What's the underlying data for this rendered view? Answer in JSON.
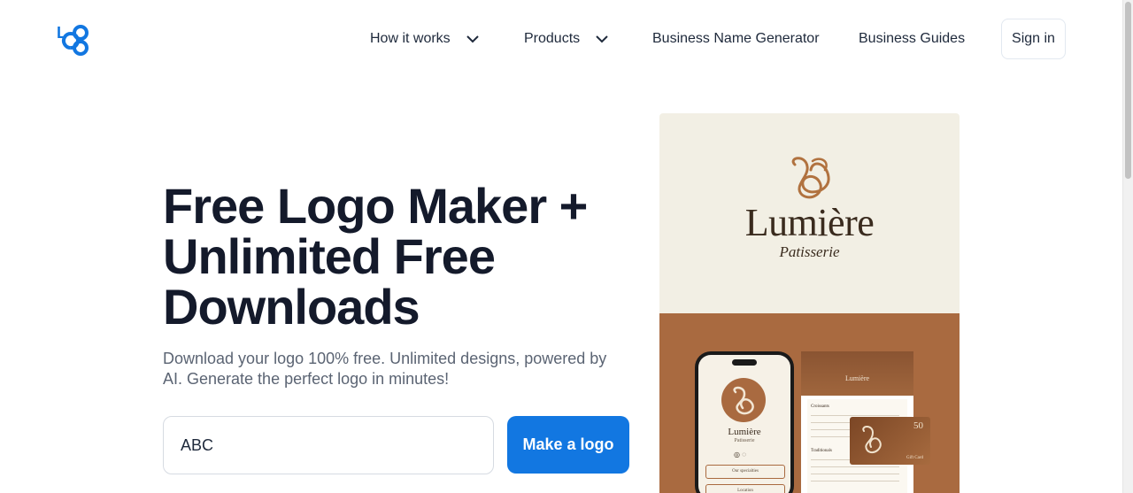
{
  "header": {
    "logo_text": "LOGO",
    "nav": [
      {
        "label": "How it works",
        "has_dropdown": true
      },
      {
        "label": "Products",
        "has_dropdown": true
      },
      {
        "label": "Business Name Generator",
        "has_dropdown": false
      },
      {
        "label": "Business Guides",
        "has_dropdown": false
      }
    ],
    "signin_label": "Sign in"
  },
  "hero": {
    "title": "Free Logo Maker + Unlimited Free Downloads",
    "subtitle": "Download your logo 100% free. Unlimited designs, powered by AI. Generate the perfect logo in minutes!",
    "input_value": "ABC",
    "cta_label": "Make a logo"
  },
  "showcase": {
    "brand_name": "Lumière",
    "brand_sub": "Patisserie",
    "phone_name": "Lumière",
    "phone_sub": "Patisserie",
    "phone_buttons": [
      "Our specialties",
      "Location"
    ],
    "menu_title": "Lumière",
    "menu_sections": [
      "Croissants",
      "Traditionals"
    ],
    "gift_value": "50",
    "gift_label": "Gift Card"
  },
  "colors": {
    "accent": "#1277e1",
    "brand_brown": "#a96a40",
    "cream": "#f2efe4"
  }
}
